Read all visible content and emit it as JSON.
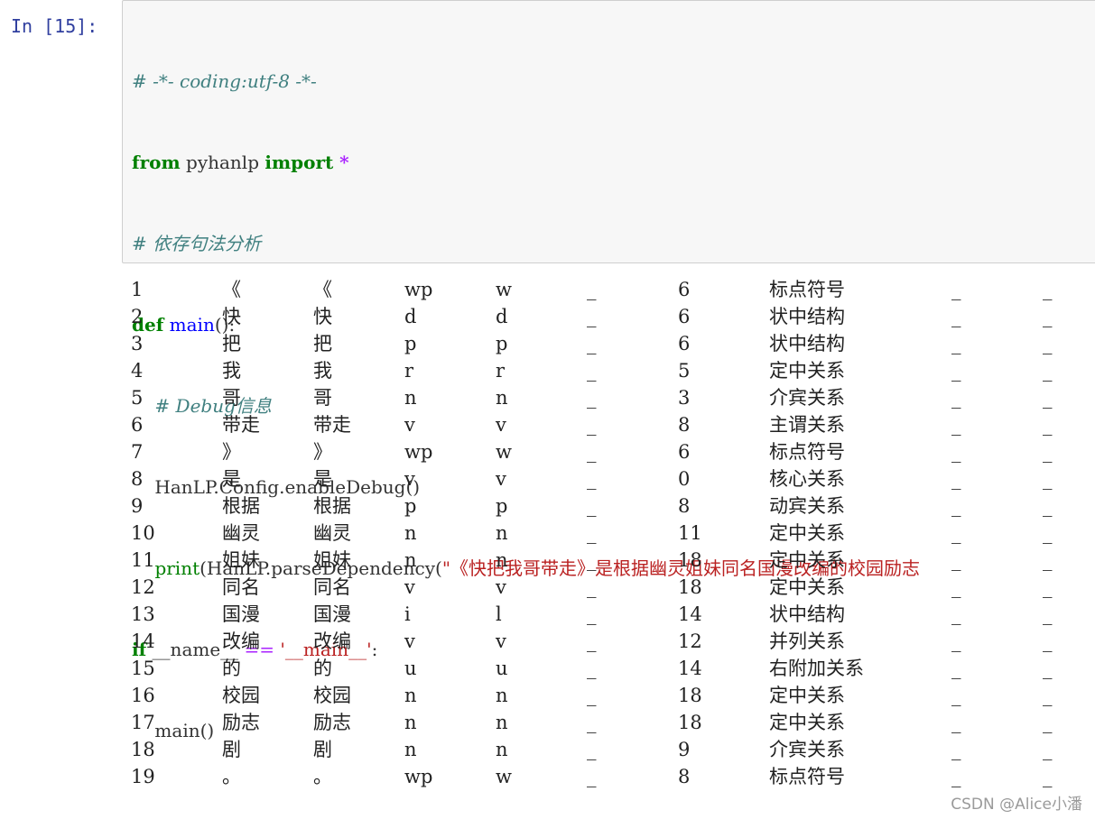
{
  "prompt": "In  [15]:",
  "code": {
    "line1": "# -*- coding:utf-8 -*-",
    "from_kw": "from",
    "module": " pyhanlp ",
    "import_kw": "import",
    "star": " *",
    "line3": "# 依存句法分析",
    "def_kw": "def",
    "func_name": " main",
    "func_tail": "():",
    "line5": "    # Debug信息",
    "line6": "    HanLP.Config.enableDebug()",
    "print_indent": "    ",
    "print_fn": "print",
    "print_call": "(HanLP.parseDependency(",
    "print_str": "\"《快把我哥带走》是根据幽灵姐妹同名国漫改编的校园励志",
    "if_kw": "if",
    "name_var": " __name__ ",
    "eq_op": "==",
    "main_str": " '__main__'",
    "colon": ":",
    "line9": "    main()"
  },
  "output": {
    "rows": [
      [
        "1",
        "《",
        "《",
        "wp",
        "w",
        "_",
        "6",
        "标点符号",
        "_",
        "_"
      ],
      [
        "2",
        "快",
        "快",
        "d",
        "d",
        "_",
        "6",
        "状中结构",
        "_",
        "_"
      ],
      [
        "3",
        "把",
        "把",
        "p",
        "p",
        "_",
        "6",
        "状中结构",
        "_",
        "_"
      ],
      [
        "4",
        "我",
        "我",
        "r",
        "r",
        "_",
        "5",
        "定中关系",
        "_",
        "_"
      ],
      [
        "5",
        "哥",
        "哥",
        "n",
        "n",
        "_",
        "3",
        "介宾关系",
        "_",
        "_"
      ],
      [
        "6",
        "带走",
        "带走",
        "v",
        "v",
        "_",
        "8",
        "主谓关系",
        "_",
        "_"
      ],
      [
        "7",
        "》",
        "》",
        "wp",
        "w",
        "_",
        "6",
        "标点符号",
        "_",
        "_"
      ],
      [
        "8",
        "是",
        "是",
        "v",
        "v",
        "_",
        "0",
        "核心关系",
        "_",
        "_"
      ],
      [
        "9",
        "根据",
        "根据",
        "p",
        "p",
        "_",
        "8",
        "动宾关系",
        "_",
        "_"
      ],
      [
        "10",
        "幽灵",
        "幽灵",
        "n",
        "n",
        "_",
        "11",
        "定中关系",
        "_",
        "_"
      ],
      [
        "11",
        "姐妹",
        "姐妹",
        "n",
        "n",
        "_",
        "18",
        "定中关系",
        "_",
        "_"
      ],
      [
        "12",
        "同名",
        "同名",
        "v",
        "v",
        "_",
        "18",
        "定中关系",
        "_",
        "_"
      ],
      [
        "13",
        "国漫",
        "国漫",
        "i",
        "l",
        "_",
        "14",
        "状中结构",
        "_",
        "_"
      ],
      [
        "14",
        "改编",
        "改编",
        "v",
        "v",
        "_",
        "12",
        "并列关系",
        "_",
        "_"
      ],
      [
        "15",
        "的",
        "的",
        "u",
        "u",
        "_",
        "14",
        "右附加关系",
        "_",
        "_"
      ],
      [
        "16",
        "校园",
        "校园",
        "n",
        "n",
        "_",
        "18",
        "定中关系",
        "_",
        "_"
      ],
      [
        "17",
        "励志",
        "励志",
        "n",
        "n",
        "_",
        "18",
        "定中关系",
        "_",
        "_"
      ],
      [
        "18",
        "剧",
        "剧",
        "n",
        "n",
        "_",
        "9",
        "介宾关系",
        "_",
        "_"
      ],
      [
        "19",
        "。",
        "。",
        "wp",
        "w",
        "_",
        "8",
        "标点符号",
        "_",
        "_"
      ]
    ]
  },
  "watermark": "CSDN @Alice小潘"
}
